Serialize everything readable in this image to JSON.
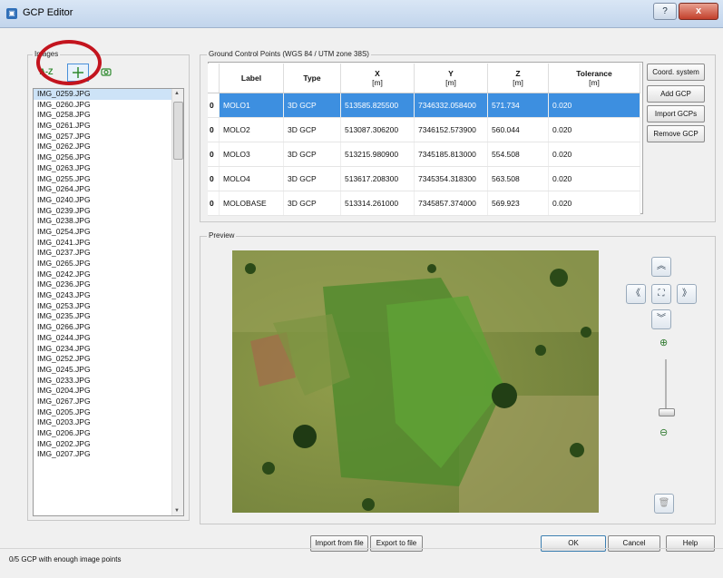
{
  "window": {
    "title": "GCP Editor",
    "help_glyph": "?",
    "close_glyph": "x"
  },
  "images": {
    "label": "Images",
    "toolbar": {
      "sort_label": "A-Z"
    },
    "items": [
      "IMG_0259.JPG",
      "IMG_0260.JPG",
      "IMG_0258.JPG",
      "IMG_0261.JPG",
      "IMG_0257.JPG",
      "IMG_0262.JPG",
      "IMG_0256.JPG",
      "IMG_0263.JPG",
      "IMG_0255.JPG",
      "IMG_0264.JPG",
      "IMG_0240.JPG",
      "IMG_0239.JPG",
      "IMG_0238.JPG",
      "IMG_0254.JPG",
      "IMG_0241.JPG",
      "IMG_0237.JPG",
      "IMG_0265.JPG",
      "IMG_0242.JPG",
      "IMG_0236.JPG",
      "IMG_0243.JPG",
      "IMG_0253.JPG",
      "IMG_0235.JPG",
      "IMG_0266.JPG",
      "IMG_0244.JPG",
      "IMG_0234.JPG",
      "IMG_0252.JPG",
      "IMG_0245.JPG",
      "IMG_0233.JPG",
      "IMG_0204.JPG",
      "IMG_0267.JPG",
      "IMG_0205.JPG",
      "IMG_0203.JPG",
      "IMG_0206.JPG",
      "IMG_0202.JPG",
      "IMG_0207.JPG"
    ]
  },
  "gcp": {
    "label": "Ground Control Points (WGS 84 / UTM zone 38S)",
    "headers": [
      {
        "title": "Label",
        "unit": ""
      },
      {
        "title": "Type",
        "unit": ""
      },
      {
        "title": "X",
        "unit": "[m]"
      },
      {
        "title": "Y",
        "unit": "[m]"
      },
      {
        "title": "Z",
        "unit": "[m]"
      },
      {
        "title": "Tolerance",
        "unit": "[m]"
      }
    ],
    "rows": [
      {
        "idx": "0",
        "label": "MOLO1",
        "type": "3D GCP",
        "x": "513585.825500",
        "y": "7346332.058400",
        "z": "571.734",
        "tol": "0.020"
      },
      {
        "idx": "0",
        "label": "MOLO2",
        "type": "3D GCP",
        "x": "513087.306200",
        "y": "7346152.573900",
        "z": "560.044",
        "tol": "0.020"
      },
      {
        "idx": "0",
        "label": "MOLO3",
        "type": "3D GCP",
        "x": "513215.980900",
        "y": "7345185.813000",
        "z": "554.508",
        "tol": "0.020"
      },
      {
        "idx": "0",
        "label": "MOLO4",
        "type": "3D GCP",
        "x": "513617.208300",
        "y": "7345354.318300",
        "z": "563.508",
        "tol": "0.020"
      },
      {
        "idx": "0",
        "label": "MOLOBASE",
        "type": "3D GCP",
        "x": "513314.261000",
        "y": "7345857.374000",
        "z": "569.923",
        "tol": "0.020"
      }
    ],
    "buttons": {
      "coord": "Coord. system",
      "add": "Add GCP",
      "import": "Import GCPs",
      "remove": "Remove GCP"
    }
  },
  "preview": {
    "label": "Preview"
  },
  "bottom": {
    "import_file": "Import from file",
    "export_file": "Export to file",
    "ok": "OK",
    "cancel": "Cancel",
    "help": "Help"
  },
  "status": "0/5 GCP with enough image points",
  "colors": {
    "selection": "#3d8fe0",
    "highlight_circle": "#c3141e"
  }
}
